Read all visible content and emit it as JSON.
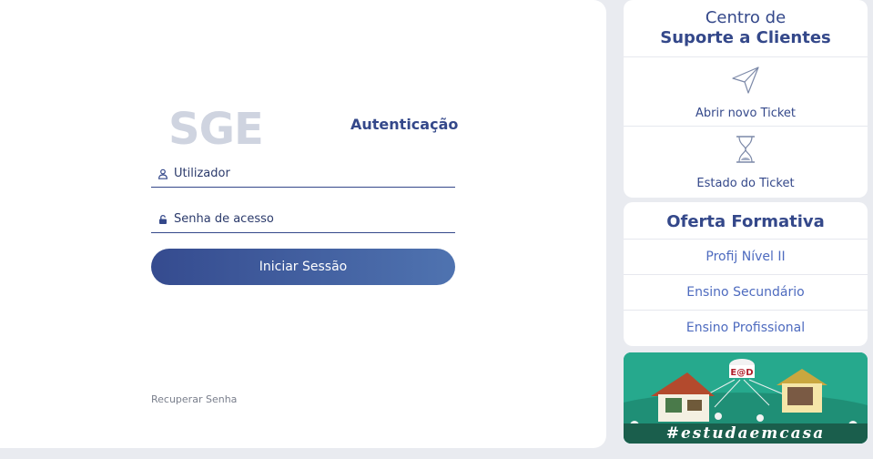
{
  "login": {
    "logo": "SGE",
    "title": "Autenticação",
    "username_placeholder": "Utilizador",
    "password_placeholder": "Senha de acesso",
    "submit_label": "Iniciar Sessão",
    "recover_label": "Recuperar Senha"
  },
  "support": {
    "title_line1": "Centro de",
    "title_line2": "Suporte a Clientes",
    "items": [
      {
        "label": "Abrir novo Ticket",
        "icon": "paper-plane-icon"
      },
      {
        "label": "Estado do Ticket",
        "icon": "hourglass-icon"
      }
    ]
  },
  "offer": {
    "title": "Oferta Formativa",
    "items": [
      {
        "label": "Profij Nível II"
      },
      {
        "label": "Ensino Secundário"
      },
      {
        "label": "Ensino Profissional"
      }
    ]
  },
  "banner": {
    "hashtag": "#estudaemcasa",
    "badge": "E@D"
  },
  "colors": {
    "primary": "#34488a",
    "link": "#4e6bbf",
    "background": "#e9ebf0",
    "banner_green": "#23a78c"
  }
}
